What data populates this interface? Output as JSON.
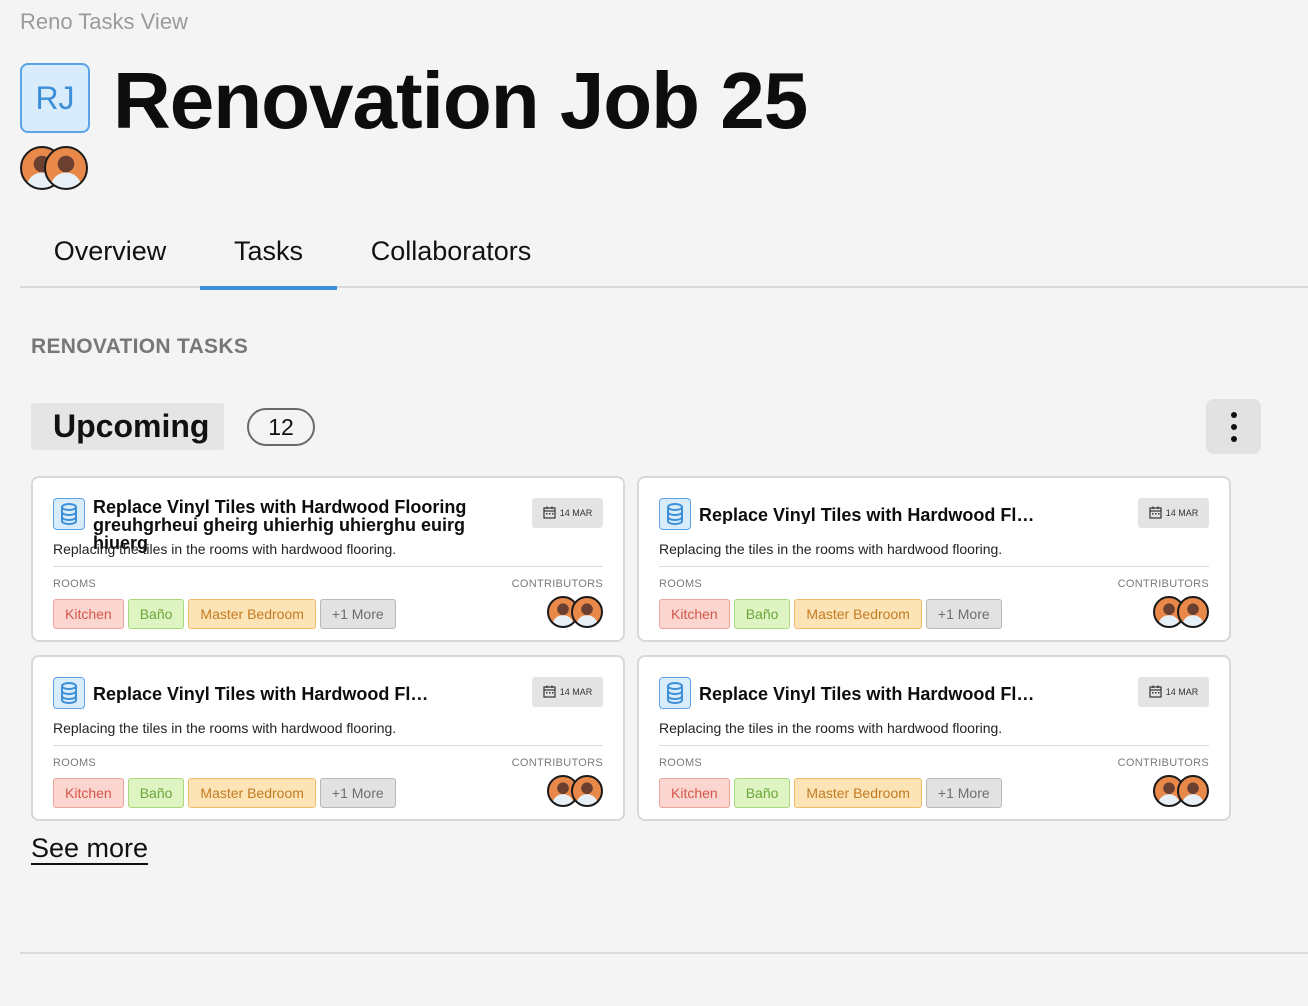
{
  "app": {
    "title": "Reno Tasks View"
  },
  "project": {
    "initials": "RJ",
    "title": "Renovation Job 25"
  },
  "tabs": [
    {
      "label": "Overview"
    },
    {
      "label": "Tasks"
    },
    {
      "label": "Collaborators"
    }
  ],
  "section": {
    "label": "RENOVATION TASKS"
  },
  "group": {
    "label": "Upcoming",
    "count": "12"
  },
  "card_labels": {
    "rooms": "ROOMS",
    "contributors": "CONTRIBUTORS"
  },
  "cards": [
    {
      "title": "Replace Vinyl Tiles with Hardwood Flooring greuhgrheui gheirg uhierhig uhierghu euirg hiuerg",
      "date": "14 MAR",
      "description": "Replacing the tiles in the rooms with hardwood flooring.",
      "rooms": [
        "Kitchen",
        "Baño",
        "Master Bedroom"
      ],
      "more": "+1 More"
    },
    {
      "title": "Replace Vinyl Tiles with Hardwood Flo...",
      "date": "14 MAR",
      "description": "Replacing the tiles in the rooms with hardwood flooring.",
      "rooms": [
        "Kitchen",
        "Baño",
        "Master Bedroom"
      ],
      "more": "+1 More"
    },
    {
      "title": "Replace Vinyl Tiles with Hardwood Flo...",
      "date": "14 MAR",
      "description": "Replacing the tiles in the rooms with hardwood flooring.",
      "rooms": [
        "Kitchen",
        "Baño",
        "Master Bedroom"
      ],
      "more": "+1 More"
    },
    {
      "title": "Replace Vinyl Tiles with Hardwood Flo...",
      "date": "14 MAR",
      "description": "Replacing the tiles in the rooms with hardwood flooring.",
      "rooms": [
        "Kitchen",
        "Baño",
        "Master Bedroom"
      ],
      "more": "+1 More"
    }
  ],
  "links": {
    "see_more": "See more"
  },
  "colors": {
    "accent": "#3d8fd8",
    "kitchen": "#d4574a",
    "bano": "#6ba53a",
    "master_bedroom": "#c27b23"
  }
}
